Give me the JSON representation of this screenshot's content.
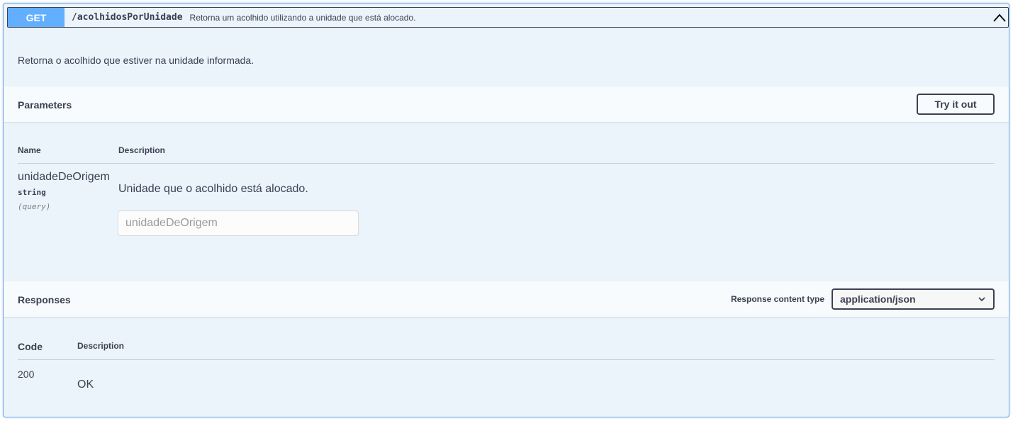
{
  "operation": {
    "method": "GET",
    "path": "/acolhidosPorUnidade",
    "summary": "Retorna um acolhido utilizando a unidade que está alocado.",
    "description": "Retorna o acolhido que estiver na unidade informada.",
    "collapse_icon": "chevron-up-icon",
    "colors": {
      "method": "#61affe",
      "background": "#ebf3fb",
      "border": "#61affe"
    }
  },
  "parameters": {
    "title": "Parameters",
    "try_label": "Try it out",
    "col_name": "Name",
    "col_description": "Description",
    "items": [
      {
        "name": "unidadeDeOrigem",
        "type": "string",
        "in": "(query)",
        "description": "Unidade que o acolhido está alocado.",
        "placeholder": "unidadeDeOrigem"
      }
    ]
  },
  "responses": {
    "title": "Responses",
    "content_type_label": "Response content type",
    "content_type_value": "application/json",
    "col_code": "Code",
    "col_description": "Description",
    "items": [
      {
        "code": "200",
        "description": "OK"
      }
    ]
  }
}
